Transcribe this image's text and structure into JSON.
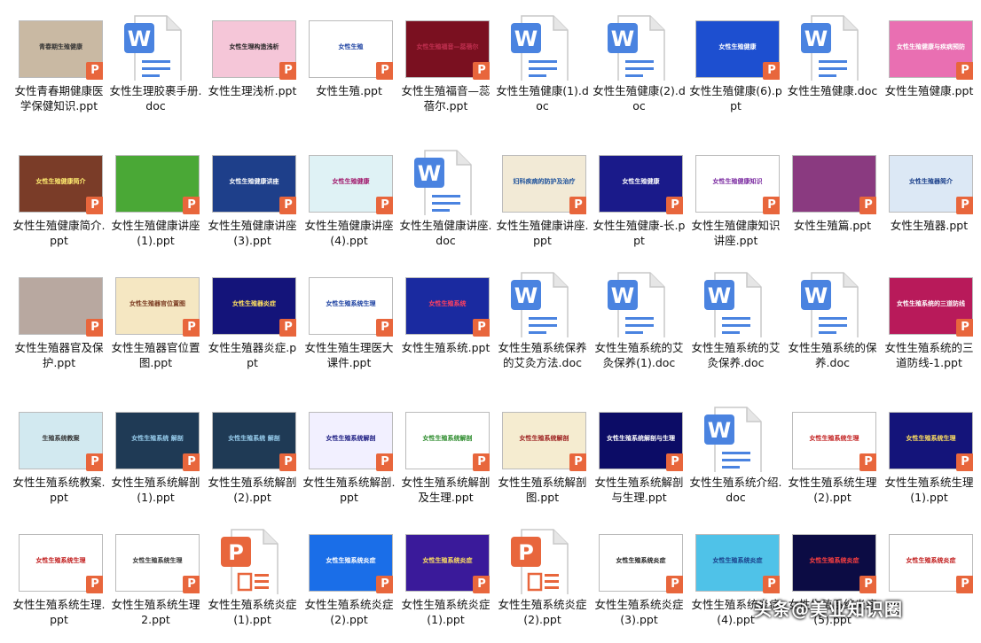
{
  "files": [
    {
      "name": "女性青春期健康医学保健知识.ppt",
      "type": "ppt",
      "thumb": {
        "bg": "#c9b9a3",
        "fg": "#333",
        "text": "青春期生殖健康"
      }
    },
    {
      "name": "女性生理胶裹手册.doc",
      "type": "doc"
    },
    {
      "name": "女性生理浅析.ppt",
      "type": "ppt",
      "thumb": {
        "bg": "#f5c6d8",
        "fg": "#222",
        "text": "女性生理构造浅析"
      }
    },
    {
      "name": "女性生殖.ppt",
      "type": "ppt",
      "thumb": {
        "bg": "#ffffff",
        "fg": "#1a3fa0",
        "text": "女性生殖"
      }
    },
    {
      "name": "女性生殖福音—蕊蓓尔.ppt",
      "type": "ppt",
      "thumb": {
        "bg": "#7a1020",
        "fg": "#c03050",
        "text": "女性生殖福音—蕊蓓尔"
      }
    },
    {
      "name": "女性生殖健康(1).doc",
      "type": "doc"
    },
    {
      "name": "女性生殖健康(2).doc",
      "type": "doc"
    },
    {
      "name": "女性生殖健康(6).ppt",
      "type": "ppt",
      "thumb": {
        "bg": "#1d4fd0",
        "fg": "#ffffff",
        "text": "女性生殖健康"
      }
    },
    {
      "name": "女性生殖健康.doc",
      "type": "doc"
    },
    {
      "name": "女性生殖健康.ppt",
      "type": "ppt",
      "thumb": {
        "bg": "#e96fb2",
        "fg": "#ffffff",
        "text": "女性生殖健康与疾病预防"
      }
    },
    {
      "name": "女性生殖健康简介.ppt",
      "type": "ppt",
      "thumb": {
        "bg": "#7a3c28",
        "fg": "#ffec70",
        "text": "女性生殖健康简介"
      }
    },
    {
      "name": "女性生殖健康讲座(1).ppt",
      "type": "ppt",
      "thumb": {
        "bg": "#4aa836",
        "fg": "#ffffff",
        "text": ""
      }
    },
    {
      "name": "女性生殖健康讲座(3).ppt",
      "type": "ppt",
      "thumb": {
        "bg": "#1e3f8a",
        "fg": "#ffffff",
        "text": "女性生殖健康讲座"
      }
    },
    {
      "name": "女性生殖健康讲座(4).ppt",
      "type": "ppt",
      "thumb": {
        "bg": "#dff2f5",
        "fg": "#a0166a",
        "text": "女性生殖健康"
      }
    },
    {
      "name": "女性生殖健康讲座.doc",
      "type": "doc"
    },
    {
      "name": "女性生殖健康讲座.ppt",
      "type": "ppt",
      "thumb": {
        "bg": "#f2ead6",
        "fg": "#1a4f9a",
        "text": "妇科疾病的防护及治疗"
      }
    },
    {
      "name": "女性生殖健康-长.ppt",
      "type": "ppt",
      "thumb": {
        "bg": "#1a1a8a",
        "fg": "#ffffff",
        "text": "女性生殖健康"
      }
    },
    {
      "name": "女性生殖健康知识讲座.ppt",
      "type": "ppt",
      "thumb": {
        "bg": "#ffffff",
        "fg": "#7a2aa0",
        "text": "女性生殖健康知识"
      }
    },
    {
      "name": "女性生殖篇.ppt",
      "type": "ppt",
      "thumb": {
        "bg": "#8a3a80",
        "fg": "#ffffff",
        "text": ""
      }
    },
    {
      "name": "女性生殖器.ppt",
      "type": "ppt",
      "thumb": {
        "bg": "#dce8f5",
        "fg": "#1a3f8a",
        "text": "女性生殖器简介"
      }
    },
    {
      "name": "女性生殖器官及保护.ppt",
      "type": "ppt",
      "thumb": {
        "bg": "#b8a8a0",
        "fg": "#ffffff",
        "text": ""
      }
    },
    {
      "name": "女性生殖器官位置图.ppt",
      "type": "ppt",
      "thumb": {
        "bg": "#f5e7c2",
        "fg": "#7a3a20",
        "text": "女性生殖器官位置图"
      }
    },
    {
      "name": "女性生殖器炎症.ppt",
      "type": "ppt",
      "thumb": {
        "bg": "#14147a",
        "fg": "#ffe060",
        "text": "女性生殖器炎症"
      }
    },
    {
      "name": "女性生殖生理医大课件.ppt",
      "type": "ppt",
      "thumb": {
        "bg": "#ffffff",
        "fg": "#1a3fa0",
        "text": "女性生殖系统生理"
      }
    },
    {
      "name": "女性生殖系统.ppt",
      "type": "ppt",
      "thumb": {
        "bg": "#1a2aa0",
        "fg": "#ff4060",
        "text": "女性生殖系统"
      }
    },
    {
      "name": "女性生殖系统保养的艾灸方法.doc",
      "type": "doc"
    },
    {
      "name": "女性生殖系统的艾灸保养(1).doc",
      "type": "doc"
    },
    {
      "name": "女性生殖系统的艾灸保养.doc",
      "type": "doc"
    },
    {
      "name": "女性生殖系统的保养.doc",
      "type": "doc"
    },
    {
      "name": "女性生殖系统的三道防线-1.ppt",
      "type": "ppt",
      "thumb": {
        "bg": "#b81a5a",
        "fg": "#ffffff",
        "text": "女性生殖系统的三道防线"
      }
    },
    {
      "name": "女性生殖系统教案.ppt",
      "type": "ppt",
      "thumb": {
        "bg": "#d2e9f0",
        "fg": "#333",
        "text": "生殖系统教案"
      }
    },
    {
      "name": "女性生殖系统解剖(1).ppt",
      "type": "ppt",
      "thumb": {
        "bg": "#1f3a55",
        "fg": "#9ad0f0",
        "text": "女性生殖系统 解剖"
      }
    },
    {
      "name": "女性生殖系统解剖(2).ppt",
      "type": "ppt",
      "thumb": {
        "bg": "#1f3a55",
        "fg": "#9ad0f0",
        "text": "女性生殖系统 解剖"
      }
    },
    {
      "name": "女性生殖系统解剖.ppt",
      "type": "ppt",
      "thumb": {
        "bg": "#f2f0ff",
        "fg": "#1a1a80",
        "text": "女性生殖系统解剖"
      }
    },
    {
      "name": "女性生殖系统解剖及生理.ppt",
      "type": "ppt",
      "thumb": {
        "bg": "#ffffff",
        "fg": "#2a8a2a",
        "text": "女性生殖系统解剖"
      }
    },
    {
      "name": "女性生殖系统解剖图.ppt",
      "type": "ppt",
      "thumb": {
        "bg": "#f5ecd0",
        "fg": "#9a1a1a",
        "text": "女性生殖系统解剖"
      }
    },
    {
      "name": "女性生殖系统解剖与生理.ppt",
      "type": "ppt",
      "thumb": {
        "bg": "#0c0c66",
        "fg": "#ffffff",
        "text": "女性生殖系统解剖与生理"
      }
    },
    {
      "name": "女性生殖系统介绍.doc",
      "type": "doc"
    },
    {
      "name": "女性生殖系统生理 (2).ppt",
      "type": "ppt",
      "thumb": {
        "bg": "#ffffff",
        "fg": "#c01a1a",
        "text": "女性生殖系统生理"
      }
    },
    {
      "name": "女性生殖系统生理(1).ppt",
      "type": "ppt",
      "thumb": {
        "bg": "#14147a",
        "fg": "#ffe060",
        "text": "女性生殖系统生理"
      }
    },
    {
      "name": "女性生殖系统生理.ppt",
      "type": "ppt",
      "thumb": {
        "bg": "#ffffff",
        "fg": "#c01a1a",
        "text": "女性生殖系统生理"
      }
    },
    {
      "name": "女性生殖系统生理2.ppt",
      "type": "ppt",
      "thumb": {
        "bg": "#ffffff",
        "fg": "#333",
        "text": "女性生殖系统生理"
      }
    },
    {
      "name": "女性生殖系统炎症 (1).ppt",
      "type": "pptfile"
    },
    {
      "name": "女性生殖系统炎症 (2).ppt",
      "type": "ppt",
      "thumb": {
        "bg": "#1a6ee8",
        "fg": "#ffffff",
        "text": "女性生殖系统炎症"
      }
    },
    {
      "name": "女性生殖系统炎症(1).ppt",
      "type": "ppt",
      "thumb": {
        "bg": "#3a1a9a",
        "fg": "#ffe060",
        "text": "女性生殖系统炎症"
      }
    },
    {
      "name": "女性生殖系统炎症(2).ppt",
      "type": "pptfile"
    },
    {
      "name": "女性生殖系统炎症(3).ppt",
      "type": "ppt",
      "thumb": {
        "bg": "#ffffff",
        "fg": "#222",
        "text": "女性生殖系统炎症"
      }
    },
    {
      "name": "女性生殖系统炎症(4).ppt",
      "type": "ppt",
      "thumb": {
        "bg": "#4fc2e8",
        "fg": "#1a3f8a",
        "text": "女性生殖系统炎症"
      }
    },
    {
      "name": "女性生殖系统炎症(5).ppt",
      "type": "ppt",
      "thumb": {
        "bg": "#0c0c44",
        "fg": "#ff4040",
        "text": "女性生殖系统炎症"
      }
    },
    {
      "name": "",
      "type": "ppt",
      "thumb": {
        "bg": "#ffffff",
        "fg": "#c01a1a",
        "text": "女性生殖系统炎症"
      }
    }
  ],
  "watermark": "头条@美业知识圈"
}
